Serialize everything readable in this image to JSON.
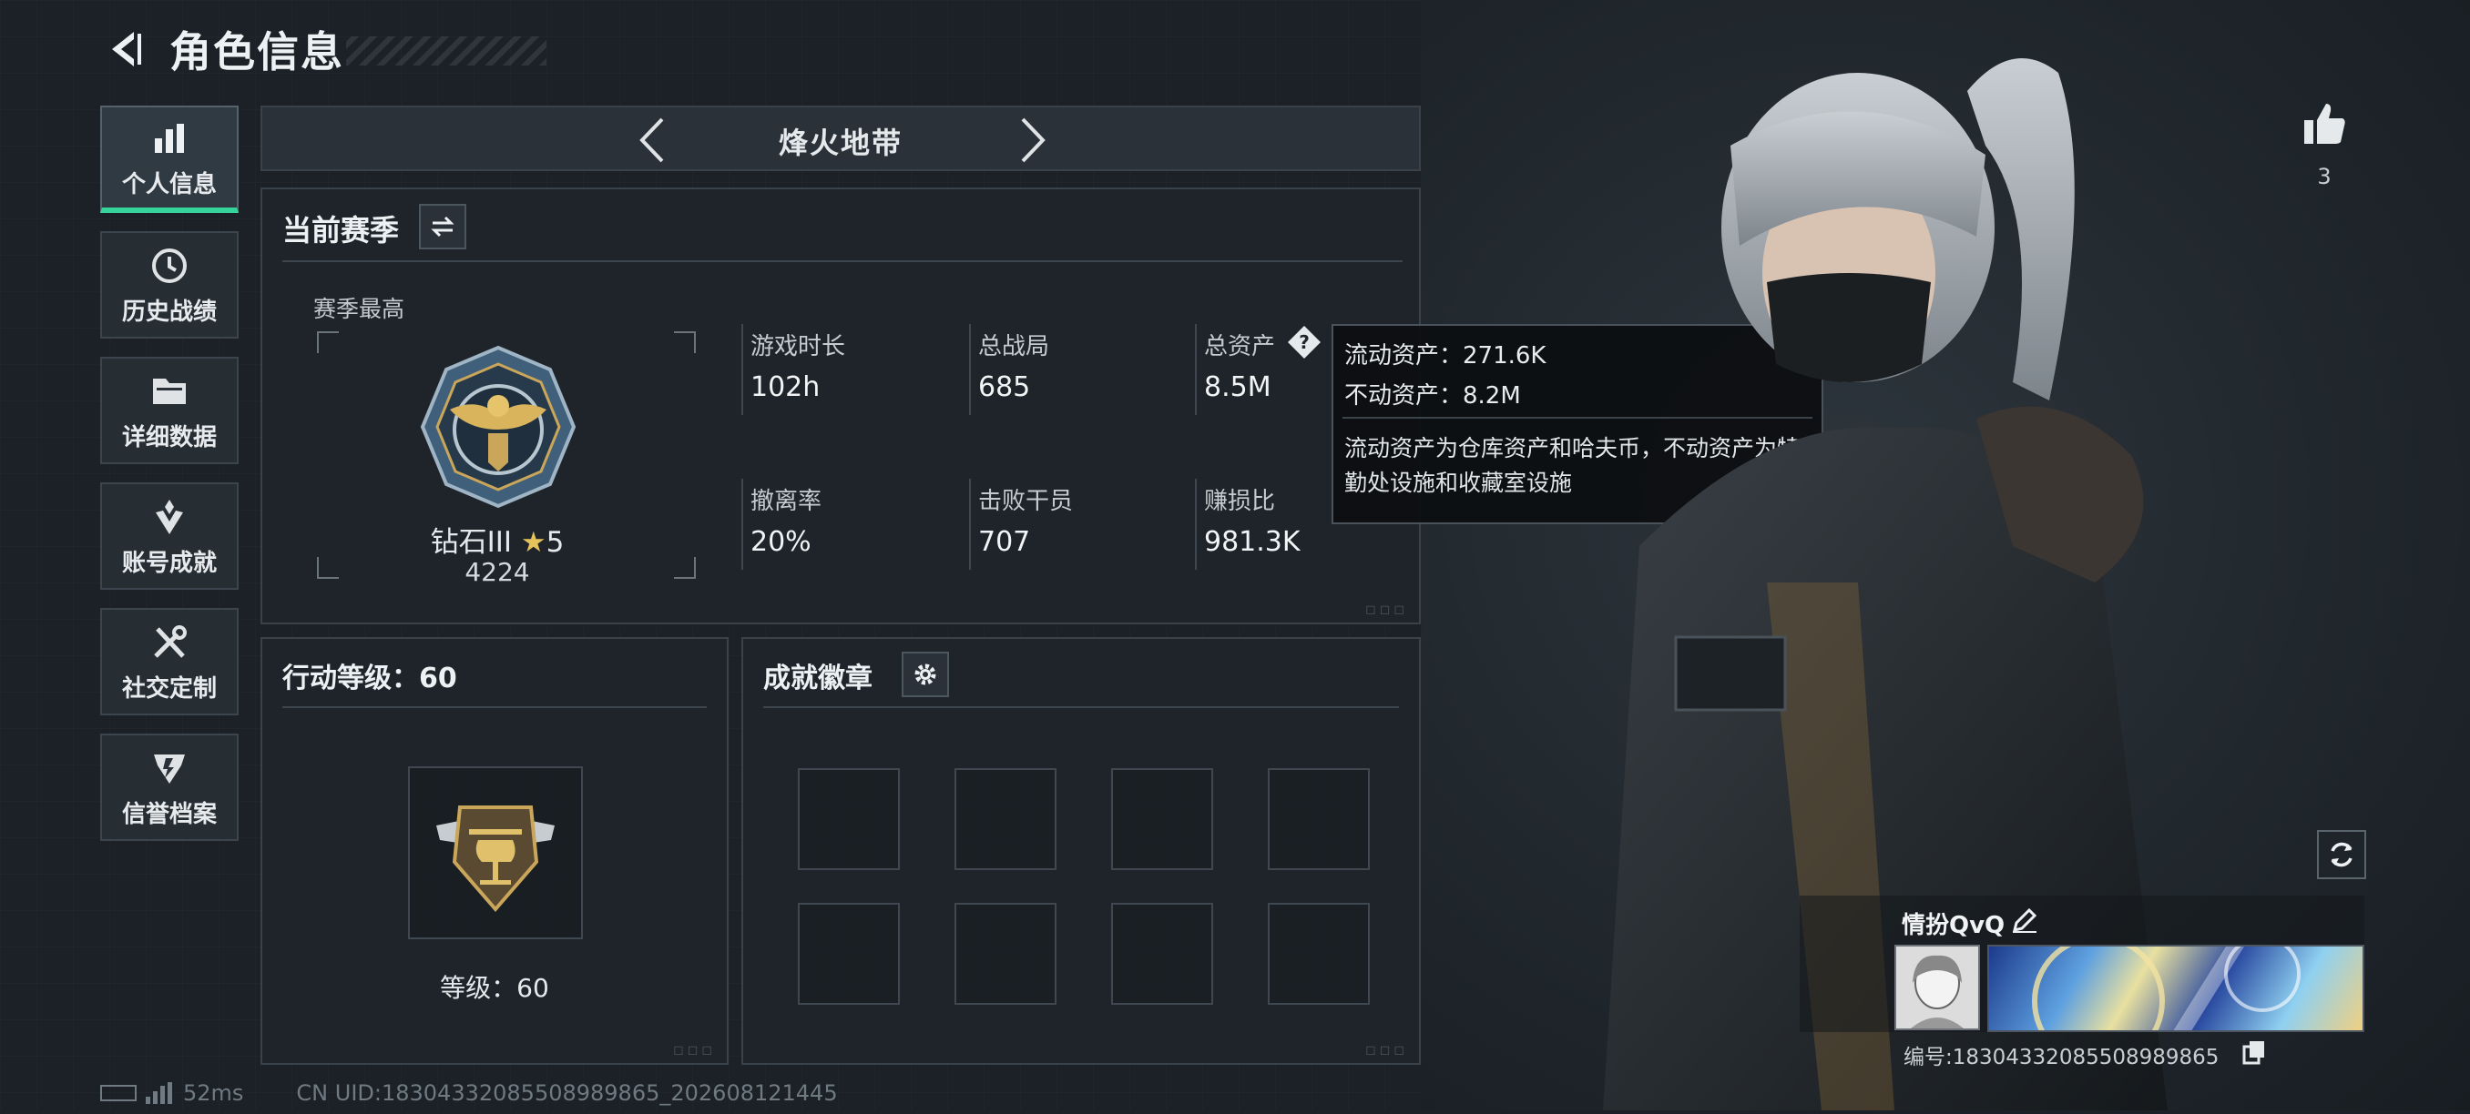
{
  "header": {
    "title": "角色信息"
  },
  "sidebar": {
    "items": [
      {
        "label": "个人信息",
        "icon": "bar-chart-icon",
        "active": true
      },
      {
        "label": "历史战绩",
        "icon": "clock-icon"
      },
      {
        "label": "详细数据",
        "icon": "folder-icon"
      },
      {
        "label": "账号成就",
        "icon": "achievement-icon"
      },
      {
        "label": "社交定制",
        "icon": "tools-icon"
      },
      {
        "label": "信誉档案",
        "icon": "reputation-icon"
      }
    ]
  },
  "tab": {
    "title": "烽火地带"
  },
  "season": {
    "title": "当前赛季",
    "peak_label": "赛季最高",
    "rank_name": "钻石III",
    "rank_stars": "5",
    "rank_points": "4224",
    "stats": [
      {
        "label": "游戏时长",
        "value": "102h"
      },
      {
        "label": "总战局",
        "value": "685"
      },
      {
        "label": "总资产",
        "value": "8.5M"
      },
      {
        "label": "撤离率",
        "value": "20%"
      },
      {
        "label": "击败干员",
        "value": "707"
      },
      {
        "label": "赚损比",
        "value": "981.3K"
      }
    ]
  },
  "tooltip": {
    "liquid": "流动资产：271.6K",
    "fixed": "不动资产：8.2M",
    "desc": "流动资产为仓库资产和哈夫币，不动资产为特勤处设施和收藏室设施"
  },
  "action_level": {
    "title": "行动等级：60",
    "level_text": "等级：60"
  },
  "achievements": {
    "title": "成就徽章"
  },
  "footer": {
    "ping": "52ms",
    "uid": "CN UID:18304332085508989865_202608121445"
  },
  "right": {
    "like_count": "3",
    "player_name": "情扮QvQ",
    "player_id": "编号:18304332085508989865"
  },
  "colors": {
    "accent": "#35d49a",
    "background": "#1b2126",
    "panel": "#1f252b",
    "tooltip_bg": "#0c0e10"
  }
}
